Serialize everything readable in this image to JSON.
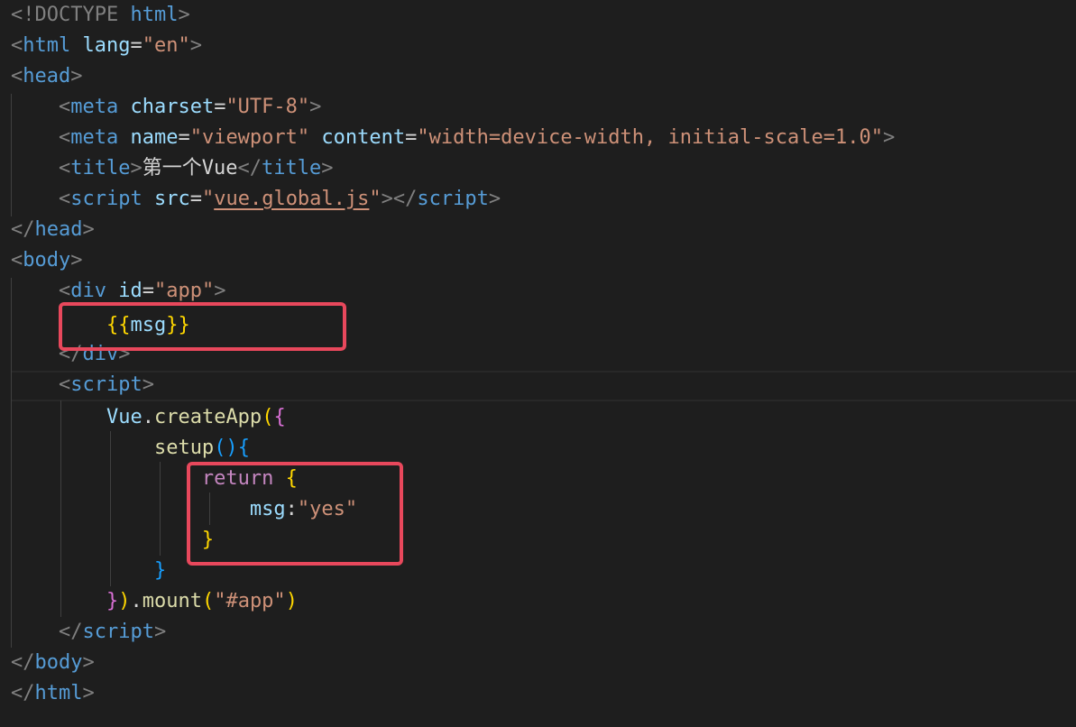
{
  "editor": {
    "l1": {
      "doctype": "!DOCTYPE",
      "html": "html"
    },
    "l2": {
      "tag": "html",
      "attr": "lang",
      "value": "\"en\""
    },
    "l3": {
      "tag": "head"
    },
    "l4": {
      "tag": "meta",
      "attr": "charset",
      "value": "\"UTF-8\""
    },
    "l5": {
      "tag": "meta",
      "attr1": "name",
      "value1": "\"viewport\"",
      "attr2": "content",
      "value2": "\"width=device-width, initial-scale=1.0\""
    },
    "l6": {
      "tag": "title",
      "text": "第一个Vue",
      "close_tag": "title"
    },
    "l7": {
      "tag": "script",
      "attr": "src",
      "value": "vue.global.js",
      "close_tag": "script"
    },
    "l8": {
      "tag": "head"
    },
    "l9": {
      "tag": "body"
    },
    "l10": {
      "tag": "div",
      "attr": "id",
      "value": "\"app\""
    },
    "l11": {
      "open": "{{",
      "var": "msg",
      "close": "}}"
    },
    "l12": {
      "tag": "div"
    },
    "l13": {
      "tag": "script"
    },
    "l14": {
      "obj": "Vue",
      "method": "createApp",
      "paren": "(",
      "brace": "{"
    },
    "l15": {
      "fn": "setup",
      "parens": "()",
      "brace": "{"
    },
    "l16": {
      "kw": "return",
      "brace": "{"
    },
    "l17": {
      "key": "msg",
      "value": "\"yes\""
    },
    "l18": {
      "brace": "}"
    },
    "l19": {
      "brace": "}"
    },
    "l20": {
      "brace": "}",
      "paren": ")",
      "method": "mount",
      "open_paren": "(",
      "arg": "\"#app\"",
      "close_paren": ")"
    },
    "l21": {
      "tag": "script"
    },
    "l22": {
      "tag": "body"
    },
    "l23": {
      "tag": "html"
    }
  }
}
